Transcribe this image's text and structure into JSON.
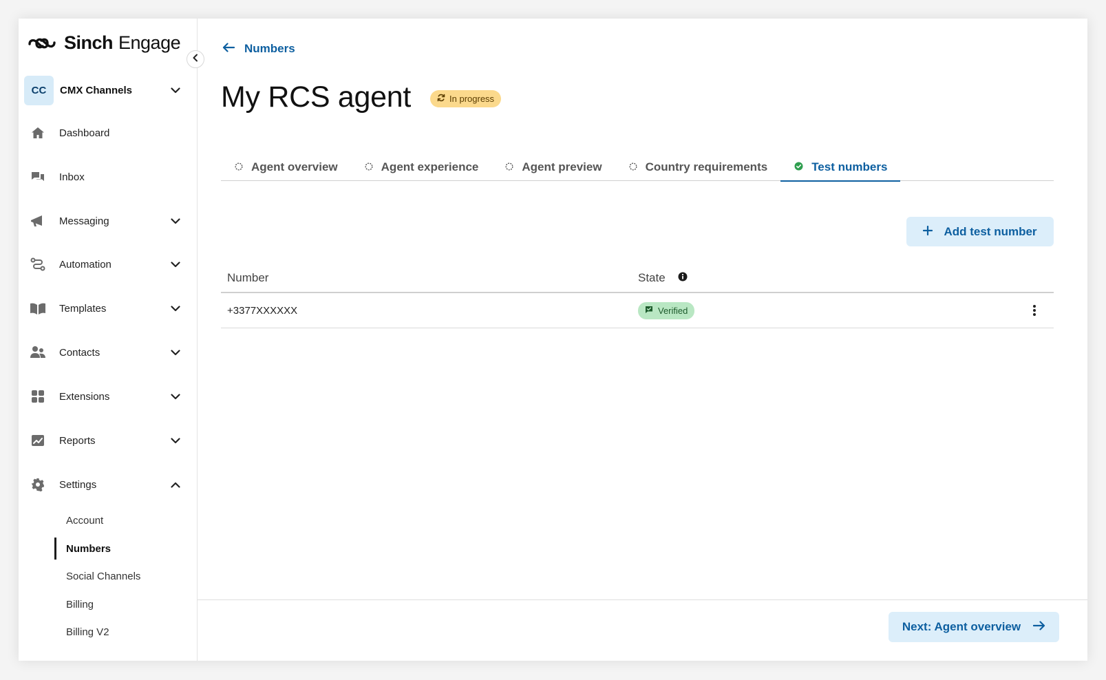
{
  "brand": {
    "name": "Sinch",
    "product": "Engage"
  },
  "account": {
    "initials": "CC",
    "name": "CMX Channels"
  },
  "sidebar": {
    "items": [
      {
        "label": "Dashboard",
        "icon": "home-icon"
      },
      {
        "label": "Inbox",
        "icon": "chat-icon"
      },
      {
        "label": "Messaging",
        "icon": "megaphone-icon",
        "expandable": true
      },
      {
        "label": "Automation",
        "icon": "flow-icon",
        "expandable": true
      },
      {
        "label": "Templates",
        "icon": "book-icon",
        "expandable": true
      },
      {
        "label": "Contacts",
        "icon": "people-icon",
        "expandable": true
      },
      {
        "label": "Extensions",
        "icon": "grid-icon",
        "expandable": true
      },
      {
        "label": "Reports",
        "icon": "chart-icon",
        "expandable": true
      },
      {
        "label": "Settings",
        "icon": "gear-icon",
        "expandable": true,
        "expanded": true
      }
    ],
    "settings_sub": [
      "Account",
      "Numbers",
      "Social Channels",
      "Billing",
      "Billing V2"
    ],
    "active_sub": "Numbers"
  },
  "header": {
    "back_label": "Numbers",
    "title": "My RCS agent",
    "status": "In progress"
  },
  "tabs": [
    {
      "label": "Agent overview",
      "complete": false
    },
    {
      "label": "Agent experience",
      "complete": false
    },
    {
      "label": "Agent preview",
      "complete": false
    },
    {
      "label": "Country requirements",
      "complete": false
    },
    {
      "label": "Test numbers",
      "complete": true,
      "active": true
    }
  ],
  "actions": {
    "add_label": "Add test number",
    "next_label": "Next: Agent overview"
  },
  "table": {
    "columns": [
      "Number",
      "State"
    ],
    "rows": [
      {
        "number": "+3377XXXXXX",
        "state": "Verified"
      }
    ]
  },
  "colors": {
    "accent": "#0d5fa0",
    "accent_bg": "#dceefa",
    "progress_badge": "#fbd98c",
    "verified_badge": "#b9e7c3"
  }
}
